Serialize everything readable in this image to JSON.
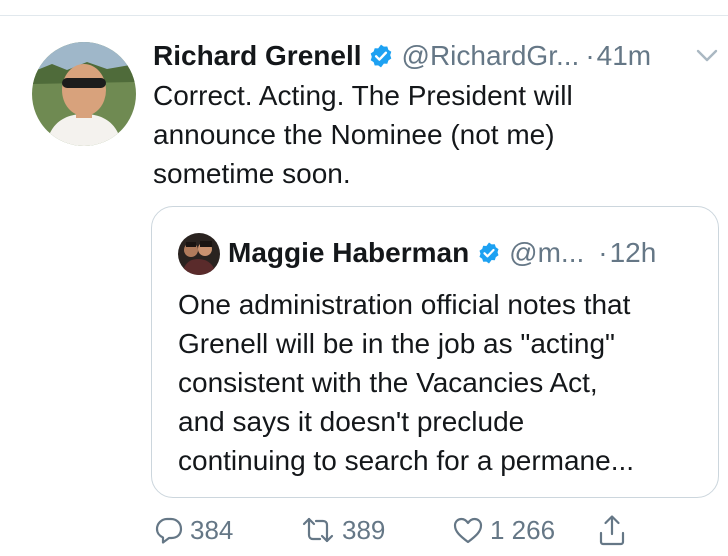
{
  "tweet": {
    "author": {
      "name": "Richard Grenell",
      "handle": "@RichardGr...",
      "verified": true
    },
    "separator": "·",
    "time": "41m",
    "text_lines": [
      "Correct. Acting. The President will",
      "announce the Nominee (not me)",
      "sometime soon."
    ]
  },
  "quoted_tweet": {
    "author": {
      "name": "Maggie Haberman",
      "handle": "@m...",
      "verified": true
    },
    "separator": "·",
    "time": "12h",
    "text_lines": [
      "One administration official notes that",
      "Grenell will be in the job as \"acting\"",
      "consistent with the Vacancies Act,",
      "and says it doesn't preclude",
      "continuing to search for a permane..."
    ]
  },
  "actions": {
    "reply_count": "384",
    "retweet_count": "389",
    "like_count": "1 266"
  },
  "colors": {
    "text": "#14171a",
    "secondary": "#657786",
    "verified": "#1da1f2",
    "border": "#ccd6dd"
  },
  "icons": [
    "verified-badge-icon",
    "chevron-down-icon",
    "reply-icon",
    "retweet-icon",
    "like-icon",
    "share-icon"
  ]
}
